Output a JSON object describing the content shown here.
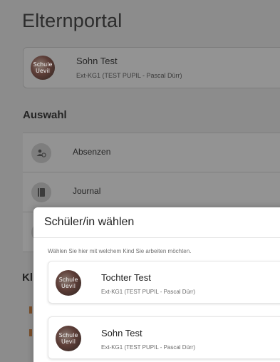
{
  "header": {
    "title": "Elternportal"
  },
  "current_child": {
    "name": "Sohn Test",
    "class_info": "Ext-KG1 (TEST PUPIL - Pascal Dürr)",
    "avatar_text": "Schule Uevil"
  },
  "selection": {
    "title": "Auswahl",
    "items": [
      {
        "label": "Absenzen",
        "icon": "person-clock-icon"
      },
      {
        "label": "Journal",
        "icon": "notebook-icon"
      },
      {
        "label": "",
        "icon": ""
      }
    ]
  },
  "partial_section": {
    "title": "Kl"
  },
  "dialog": {
    "title": "Schüler/in wählen",
    "hint": "Wählen Sie hier mit welchem Kind Sie arbeiten möchten.",
    "options": [
      {
        "name": "Tochter Test",
        "class_info": "Ext-KG1 (TEST PUPIL - Pascal Dürr)",
        "avatar_text": "Schule Uevil"
      },
      {
        "name": "Sohn Test",
        "class_info": "Ext-KG1 (TEST PUPIL - Pascal Dürr)",
        "avatar_text": "Schule Uevil"
      }
    ]
  }
}
